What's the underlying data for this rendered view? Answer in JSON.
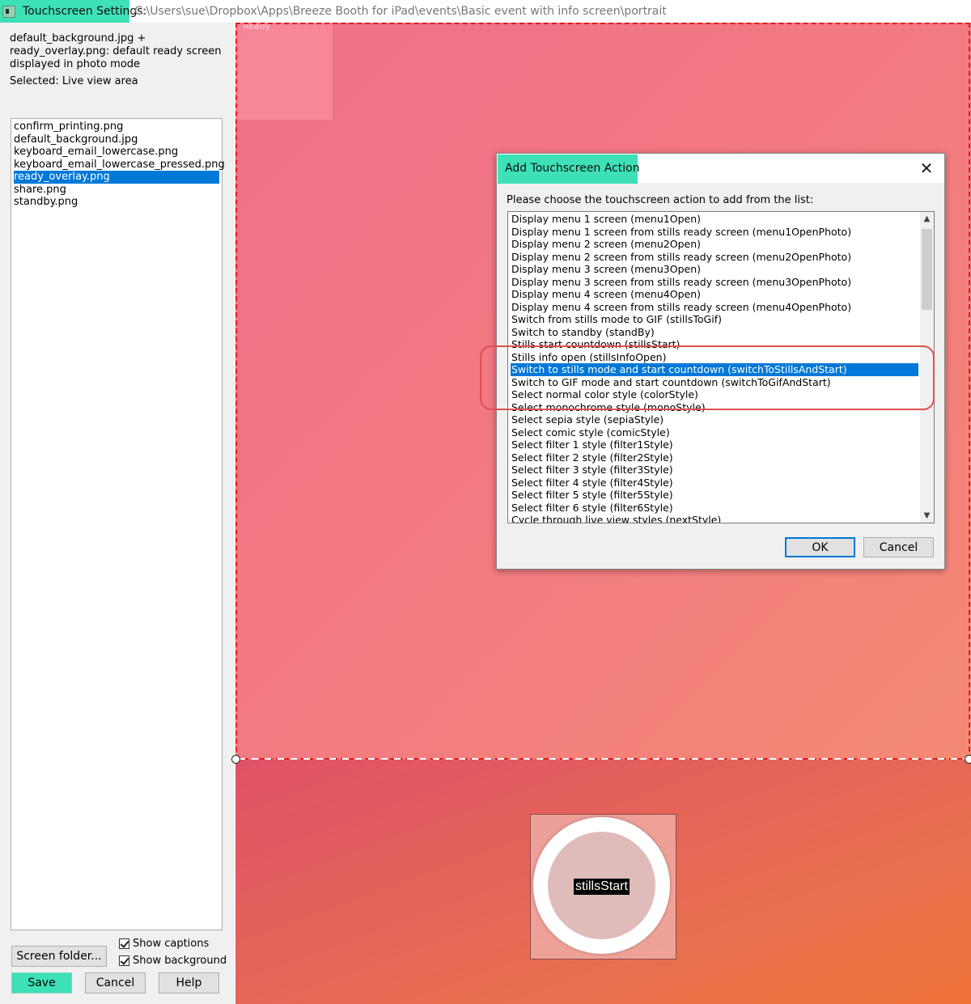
{
  "window": {
    "title": "Touchscreen Settings:",
    "path": "C:\\Users\\sue\\Dropbox\\Apps\\Breeze Booth for iPad\\events\\Basic event with info screen\\portrait"
  },
  "left_panel": {
    "description": "default_background.jpg + ready_overlay.png: default ready screen displayed in photo mode",
    "selected": "Selected: Live view area",
    "files": [
      "confirm_printing.png",
      "default_background.jpg",
      "keyboard_email_lowercase.png",
      "keyboard_email_lowercase_pressed.png",
      "ready_overlay.png",
      "share.png",
      "standby.png"
    ],
    "selected_file_index": 4,
    "screen_folder_label": "Screen folder...",
    "show_captions_label": "Show captions",
    "show_background_label": "Show background",
    "save_label": "Save",
    "cancel_label": "Cancel",
    "help_label": "Help"
  },
  "preview": {
    "ready_label": "Ready",
    "start_caption": "stillsStart"
  },
  "dialog": {
    "title": "Add Touchscreen Action",
    "prompt": "Please choose the touchscreen action to add from the list:",
    "actions": [
      "Display menu 1 screen (menu1Open)",
      "Display menu 1 screen from stills ready screen (menu1OpenPhoto)",
      "Display menu 2 screen (menu2Open)",
      "Display menu 2 screen from stills ready screen (menu2OpenPhoto)",
      "Display menu 3 screen (menu3Open)",
      "Display menu 3 screen from stills ready screen (menu3OpenPhoto)",
      "Display menu 4 screen (menu4Open)",
      "Display menu 4 screen from stills ready screen (menu4OpenPhoto)",
      "Switch from stills mode to GIF (stillsToGif)",
      "Switch to standby (standBy)",
      "Stills start countdown (stillsStart)",
      "Stills info open (stillsInfoOpen)",
      "Switch to stills mode and start countdown (switchToStillsAndStart)",
      "Switch to GIF mode and start countdown (switchToGifAndStart)",
      "Select normal color style (colorStyle)",
      "Select monochrome style (monoStyle)",
      "Select sepia style (sepiaStyle)",
      "Select comic style (comicStyle)",
      "Select filter 1 style (filter1Style)",
      "Select filter 2 style (filter2Style)",
      "Select filter 3 style (filter3Style)",
      "Select filter 4 style (filter4Style)",
      "Select filter 5 style (filter5Style)",
      "Select filter 6 style (filter6Style)",
      "Cycle through live view styles (nextStyle)"
    ],
    "selected_action_index": 12,
    "ok_label": "OK",
    "cancel_label": "Cancel"
  },
  "colors": {
    "highlight": "#3ee0b6",
    "selection": "#0078d7",
    "live_area_border": "#e41b1b",
    "callout": "#e05050"
  }
}
